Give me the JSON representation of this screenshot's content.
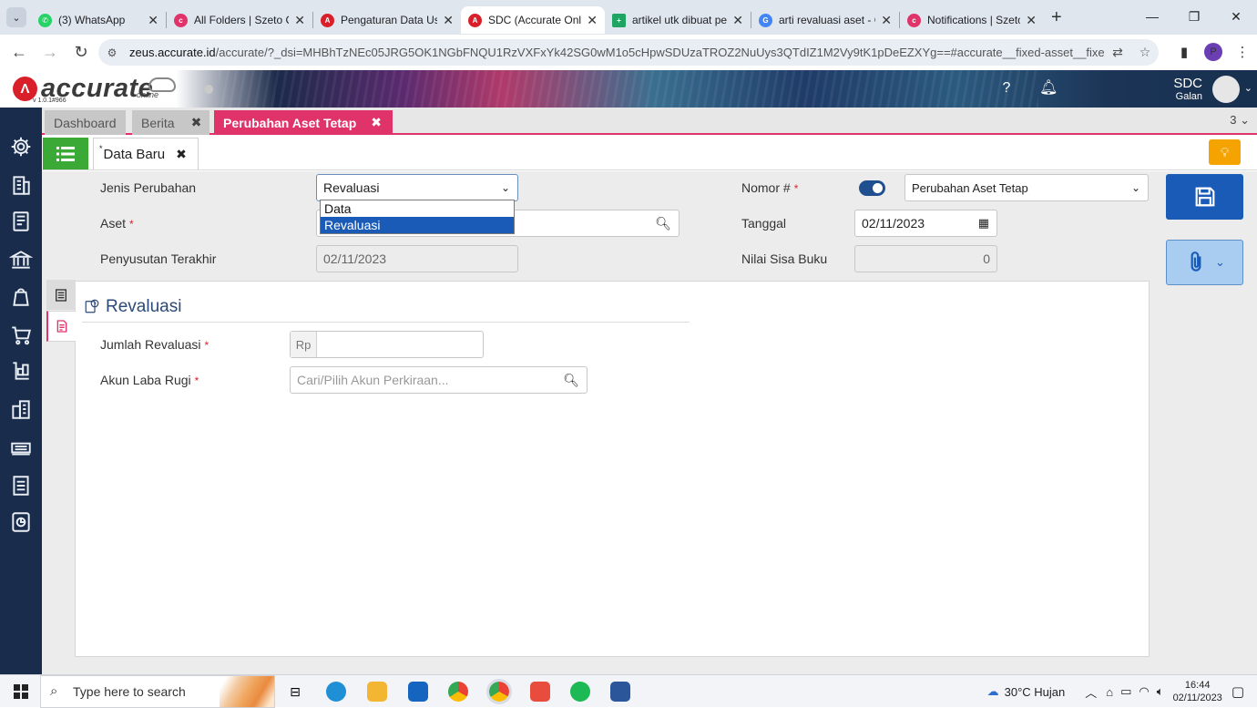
{
  "browser": {
    "tabs": [
      {
        "title": "(3) WhatsApp",
        "color": "#25d366"
      },
      {
        "title": "All Folders | Szeto C",
        "color": "#e0336a"
      },
      {
        "title": "Pengaturan Data Us",
        "color": "#d9202a"
      },
      {
        "title": "SDC (Accurate Onlin",
        "color": "#d9202a",
        "active": true
      },
      {
        "title": "artikel utk dibuat pe",
        "color": "#1fa463"
      },
      {
        "title": "arti revaluasi aset - C",
        "color": "#4285f4"
      },
      {
        "title": "Notifications | Szeto",
        "color": "#e0336a"
      }
    ],
    "url_host": "zeus.accurate.id",
    "url_path": "/accurate/?_dsi=MHBhTzNEc05JRG5OK1NGbFNQU1RzVXFxYk42SG0wM1o5cHpwSDUzaTROZ2NuUys3QTdIZ1M2Vy9tK1pDeEZXYg==#accurate__fixed-asset__fixed-asset-edited",
    "profile_initial": "P"
  },
  "app": {
    "logo_text": "accurate",
    "logo_sub": "online",
    "version": "v 1.0.1#966",
    "user_company": "SDC",
    "user_name": "Galan"
  },
  "module_tabs": [
    {
      "label": "Dashboard",
      "closable": false
    },
    {
      "label": "Berita",
      "closable": true
    },
    {
      "label": "Perubahan Aset Tetap",
      "closable": true,
      "active": true
    }
  ],
  "module_tab_count": "3",
  "subtab": {
    "label": "Data Baru",
    "dirty": "*"
  },
  "form": {
    "jenis_label": "Jenis Perubahan",
    "jenis_value": "Revaluasi",
    "jenis_options": [
      "Data",
      "Revaluasi"
    ],
    "aset_label": "Aset",
    "penyusutan_label": "Penyusutan Terakhir",
    "penyusutan_value": "02/11/2023",
    "nomor_label": "Nomor #",
    "nomor_value": "Perubahan Aset Tetap",
    "tanggal_label": "Tanggal",
    "tanggal_value": "02/11/2023",
    "nilai_label": "Nilai Sisa Buku",
    "nilai_value": "0",
    "required_mark": "*"
  },
  "panel": {
    "title": "Revaluasi",
    "jumlah_label": "Jumlah Revaluasi",
    "currency": "Rp",
    "akun_label": "Akun Laba Rugi",
    "akun_placeholder": "Cari/Pilih Akun Perkiraan..."
  },
  "taskbar": {
    "search_placeholder": "Type here to search",
    "weather": "30°C  Hujan",
    "time": "16:44",
    "date": "02/11/2023"
  },
  "colors": {
    "accent": "#e0336a",
    "primary": "#1a5bb8",
    "sidebar": "#192c4b",
    "green": "#3aa935"
  }
}
